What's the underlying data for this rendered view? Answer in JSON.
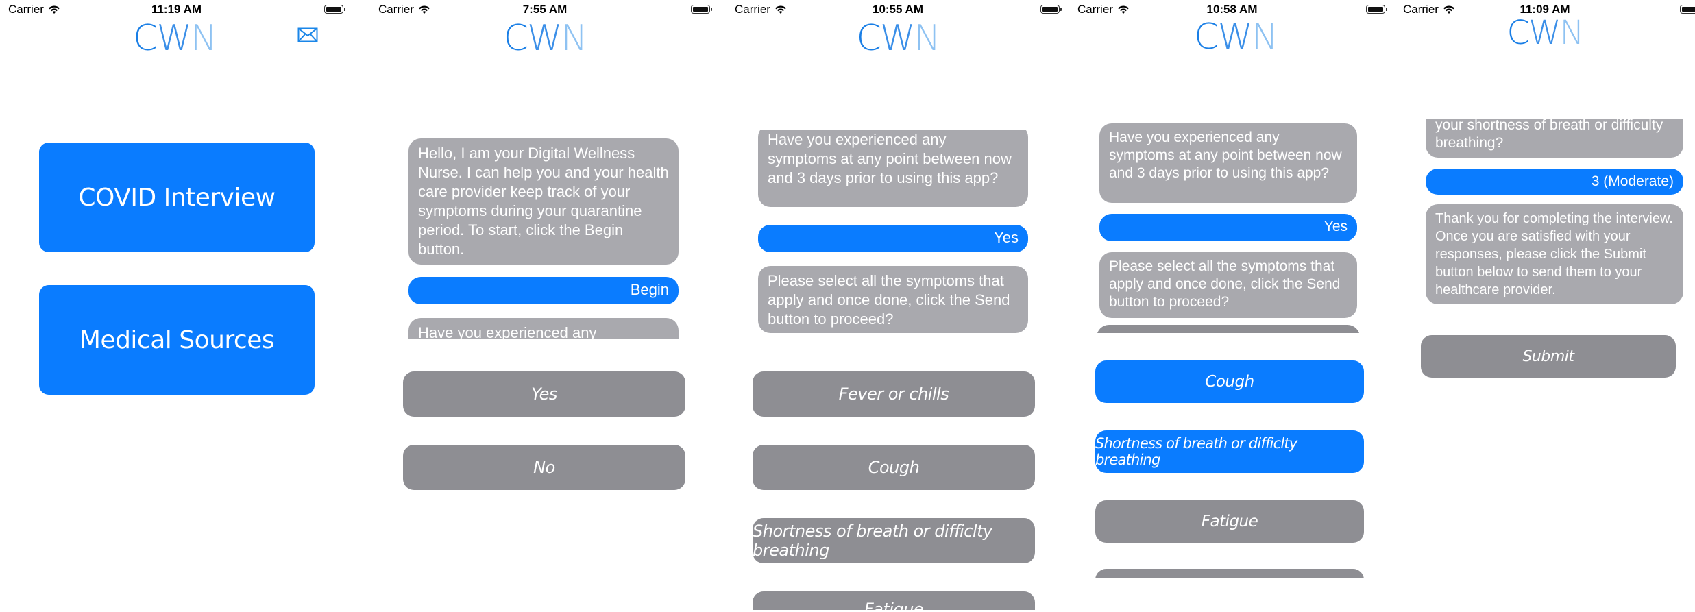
{
  "status": {
    "carrier": "Carrier",
    "times": [
      "11:19 AM",
      "7:55 AM",
      "10:55 AM",
      "10:58 AM",
      "11:09 AM"
    ]
  },
  "logo": {
    "c": "C",
    "w": "W",
    "n": "N"
  },
  "icons": {
    "mail": "envelope-icon",
    "wifi": "wifi-icon",
    "battery": "battery-icon"
  },
  "colors": {
    "accent": "#0a7cff",
    "bubble_grey": "#a9a9ae",
    "option_grey": "#8e8e93",
    "logo_blue": "#1a7fe6"
  },
  "screen1": {
    "buttons": [
      "COVID Interview",
      "Medical Sources"
    ]
  },
  "screen2": {
    "greeting": "Hello, I am your Digital Wellness Nurse. I can help you and your health care provider keep track of your symptoms during your quarantine period. To start, click the Begin button.",
    "reply": "Begin",
    "partial": "Have you experienced any",
    "options": [
      "Yes",
      "No"
    ]
  },
  "screen3": {
    "question": "Have you experienced any symptoms at any point between now and 3 days prior to using this app?",
    "reply": "Yes",
    "instruction": "Please select all the symptoms that apply and once done, click the Send button to proceed?",
    "options": [
      "Fever or chills",
      "Cough",
      "Shortness of breath or difficlty breathing",
      "Fatigue"
    ]
  },
  "screen4": {
    "question": "Have you experienced any symptoms at any point between now and 3 days prior to using this app?",
    "reply": "Yes",
    "instruction": "Please select all the symptoms that apply and once done, click the Send button to proceed?",
    "options": [
      "Cough",
      "Shortness of breath or difficlty breathing",
      "Fatigue"
    ],
    "selected": [
      "Cough",
      "Shortness of breath or difficlty breathing"
    ]
  },
  "screen5": {
    "partial": "your shortness of breath or difficulty breathing?",
    "reply": "3 (Moderate)",
    "thanks": "Thank you for completing the interview. Once you are satisfied with your responses, please click the Submit button below to send them to your healthcare provider.",
    "submit": "Submit"
  }
}
